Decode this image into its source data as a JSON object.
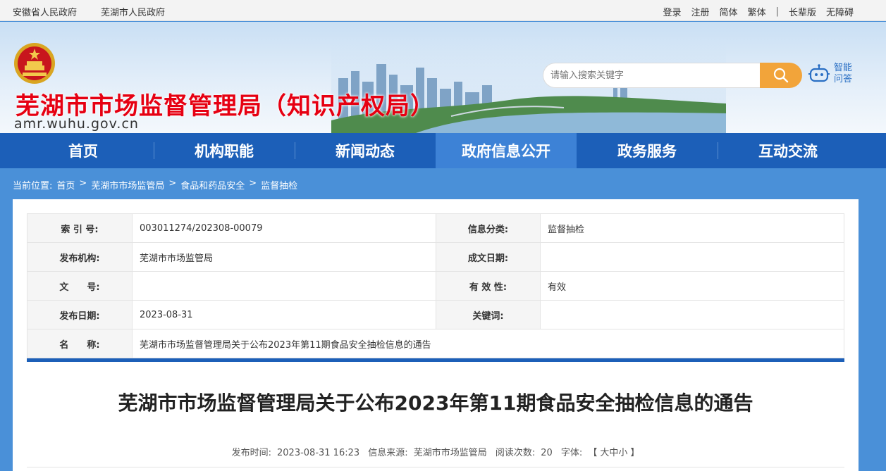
{
  "topbar": {
    "links_left": [
      "安徽省人民政府",
      "芜湖市人民政府"
    ],
    "login": "登录",
    "register": "注册",
    "simplified": "简体",
    "traditional": "繁体",
    "separator": "|",
    "elder": "长辈版",
    "accessible": "无障碍"
  },
  "header": {
    "site_title": "芜湖市市场监督管理局（知识产权局）",
    "domain": "amr.wuhu.gov.cn",
    "search_placeholder": "请输入搜索关键字",
    "ai_label": "智能问答"
  },
  "nav": {
    "items": [
      "首页",
      "机构职能",
      "新闻动态",
      "政府信息公开",
      "政务服务",
      "互动交流"
    ],
    "active_index": 3
  },
  "breadcrumb": {
    "label": "当前位置:",
    "items": [
      "首页",
      "芜湖市市场监管局",
      "食品和药品安全",
      "监督抽检"
    ],
    "arrow": ">"
  },
  "meta": {
    "index_label": "索 引 号:",
    "index_value": "003011274/202308-00079",
    "category_label": "信息分类:",
    "category_value": "监督抽检",
    "publisher_label": "发布机构:",
    "publisher_value": "芜湖市市场监管局",
    "written_date_label": "成文日期:",
    "written_date_value": "",
    "doc_no_label": "文　　号:",
    "doc_no_value": "",
    "validity_label": "有 效 性:",
    "validity_value": "有效",
    "pub_date_label": "发布日期:",
    "pub_date_value": "2023-08-31",
    "keywords_label": "关键词:",
    "keywords_value": "",
    "name_label": "名　　称:",
    "name_value": "芜湖市市场监督管理局关于公布2023年第11期食品安全抽检信息的通告"
  },
  "article": {
    "title": "芜湖市市场监督管理局关于公布2023年第11期食品安全抽检信息的通告",
    "publish_time_label": "发布时间:",
    "publish_time": "2023-08-31 16:23",
    "source_label": "信息来源:",
    "source": "芜湖市市场监管局",
    "views_label": "阅读次数:",
    "views": "20",
    "font_label": "字体:",
    "font_open": "【",
    "font_large": "大",
    "font_medium": "中",
    "font_small": "小",
    "font_close": "】"
  },
  "colors": {
    "title_red": "#e60012",
    "nav_blue": "#1c5fb8",
    "nav_active": "#3d82d6",
    "search_orange": "#f2a43a",
    "page_bg": "#4a90d8"
  }
}
